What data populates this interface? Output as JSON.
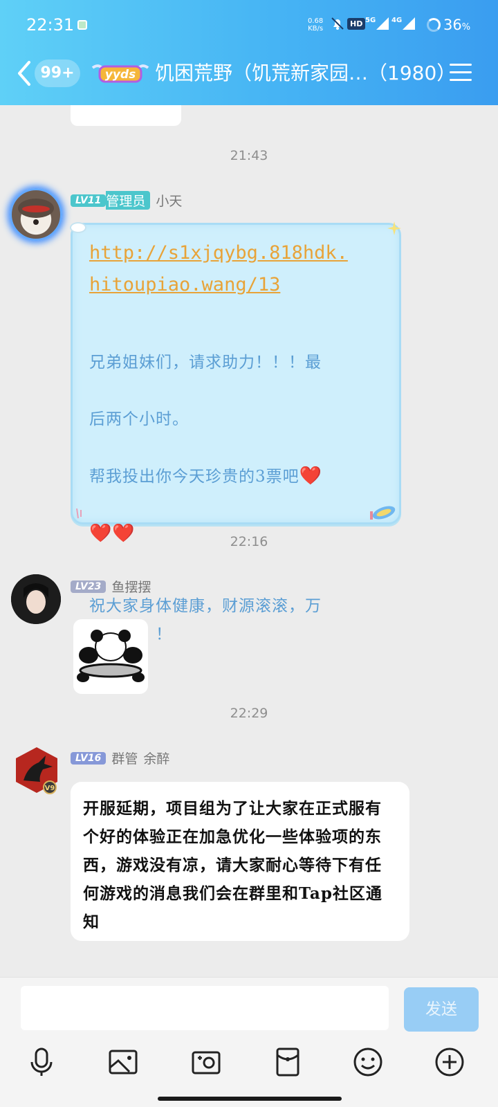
{
  "status_bar": {
    "time": "22:31",
    "net_speed_value": "0.68",
    "net_speed_unit": "KB/s",
    "hd_label": "HD",
    "signal1_label": "5G",
    "signal2_label": "4G",
    "battery_percent": "36",
    "battery_unit": "%"
  },
  "header": {
    "unread_badge": "99+",
    "group_title": "饥困荒野（饥荒新家园…（1980）",
    "colors": {
      "gradient_start": "#5fd0f7",
      "gradient_end": "#3a9df0"
    }
  },
  "messages": [
    {
      "timestamp": "21:43"
    },
    {
      "level": "LV11",
      "role": "管理员",
      "sender": "小天",
      "link_line1": "http://s1xjqybg.818hdk.",
      "link_line2": "hitoupiao.wang/13",
      "text_para1_line1": "兄弟姐妹们，请求助力！！！最",
      "text_para1_line2": "后两个小时。",
      "text_para1_line3": "帮我投出你今天珍贵的3票吧",
      "hearts": "❤️❤️",
      "heart_single": "❤️",
      "text_para2_line1": "祝大家身体健康，财源滚滚，万",
      "text_para2_line2": "事如意！！"
    },
    {
      "timestamp": "22:16"
    },
    {
      "level": "LV23",
      "sender": "鱼摆摆"
    },
    {
      "timestamp": "22:29"
    },
    {
      "level": "LV16",
      "role": "群管",
      "sender": "余醉",
      "vip_badge": "V9",
      "text": "开服延期，项目组为了让大家在正式服有个好的体验正在加急优化一些体验项的东西，游戏没有凉，请大家耐心等待下有任何游戏的消息我们会在群里和Tap社区通知"
    }
  ],
  "input": {
    "placeholder": "",
    "send_label": "发送"
  },
  "toolbar_icons": [
    "microphone-icon",
    "image-icon",
    "camera-icon",
    "red-packet-icon",
    "emoji-icon",
    "plus-icon"
  ]
}
